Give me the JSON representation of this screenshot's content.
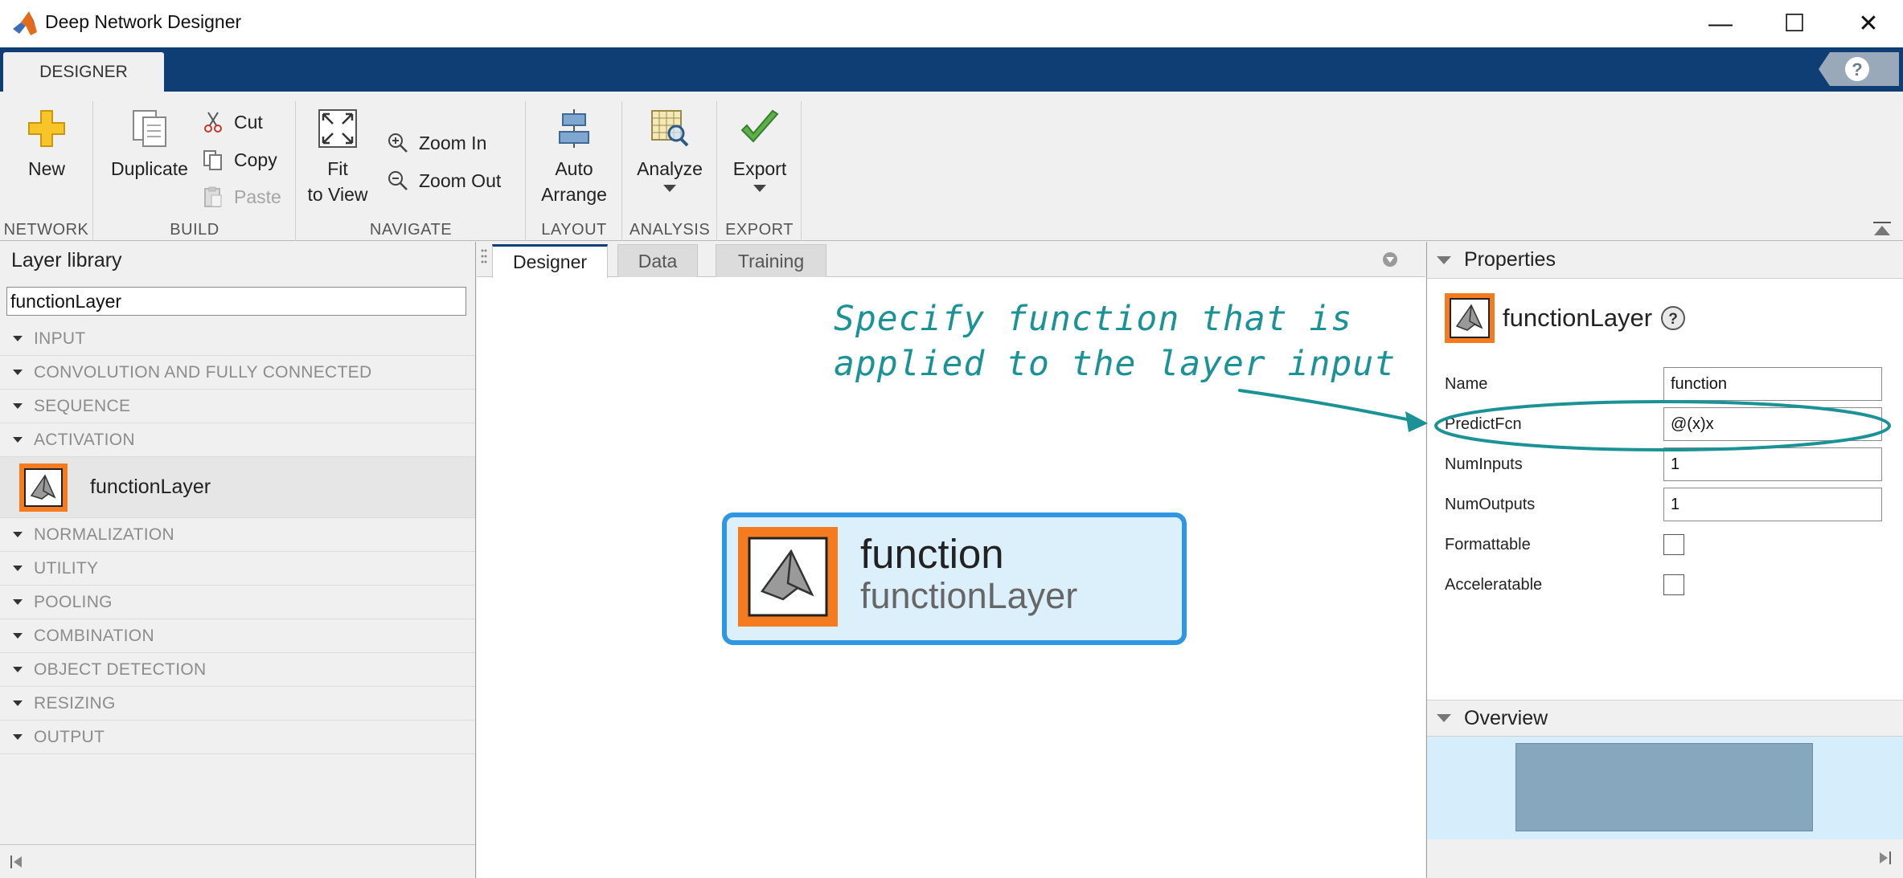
{
  "window": {
    "title": "Deep Network Designer",
    "minimize_glyph": "—",
    "maximize_glyph": "☐",
    "close_glyph": "✕"
  },
  "ribbon": {
    "tab_label": "DESIGNER",
    "help_icon": "help-icon",
    "groups": {
      "network": {
        "label": "NETWORK",
        "new_label": "New"
      },
      "build": {
        "label": "BUILD",
        "duplicate_label": "Duplicate",
        "cut_label": "Cut",
        "copy_label": "Copy",
        "paste_label": "Paste"
      },
      "navigate": {
        "label": "NAVIGATE",
        "fit_label_line1": "Fit",
        "fit_label_line2": "to View",
        "zoom_in_label": "Zoom In",
        "zoom_out_label": "Zoom Out"
      },
      "layout": {
        "label": "LAYOUT",
        "auto_line1": "Auto",
        "auto_line2": "Arrange"
      },
      "analysis": {
        "label": "ANALYSIS",
        "analyze_label": "Analyze"
      },
      "export": {
        "label": "EXPORT",
        "export_label": "Export"
      }
    }
  },
  "layer_library": {
    "header": "Layer library",
    "search_value": "functionLayer",
    "categories_top": [
      "INPUT",
      "CONVOLUTION AND FULLY CONNECTED",
      "SEQUENCE",
      "ACTIVATION"
    ],
    "activation_item": "functionLayer",
    "categories_bottom": [
      "NORMALIZATION",
      "UTILITY",
      "POOLING",
      "COMBINATION",
      "OBJECT DETECTION",
      "RESIZING",
      "OUTPUT"
    ]
  },
  "canvas": {
    "tabs": [
      "Designer",
      "Data",
      "Training"
    ],
    "annotation_line1": "Specify function that is",
    "annotation_line2": "applied to the layer input",
    "node_name": "function",
    "node_type": "functionLayer"
  },
  "properties": {
    "header": "Properties",
    "layer_type": "functionLayer",
    "fields": {
      "name": {
        "label": "Name",
        "value": "function"
      },
      "predict": {
        "label": "PredictFcn",
        "value": "@(x)x"
      },
      "inputs": {
        "label": "NumInputs",
        "value": "1"
      },
      "outputs": {
        "label": "NumOutputs",
        "value": "1"
      },
      "formattable": {
        "label": "Formattable",
        "checked": false
      },
      "accelerable": {
        "label": "Acceleratable",
        "checked": false
      }
    }
  },
  "overview": {
    "header": "Overview"
  },
  "colors": {
    "ribbon_blue": "#0e3e74",
    "annotation_teal": "#1a9296",
    "node_border": "#2f97e2",
    "node_fill": "#dcf0fb",
    "layer_icon_orange": "#f47b20"
  }
}
